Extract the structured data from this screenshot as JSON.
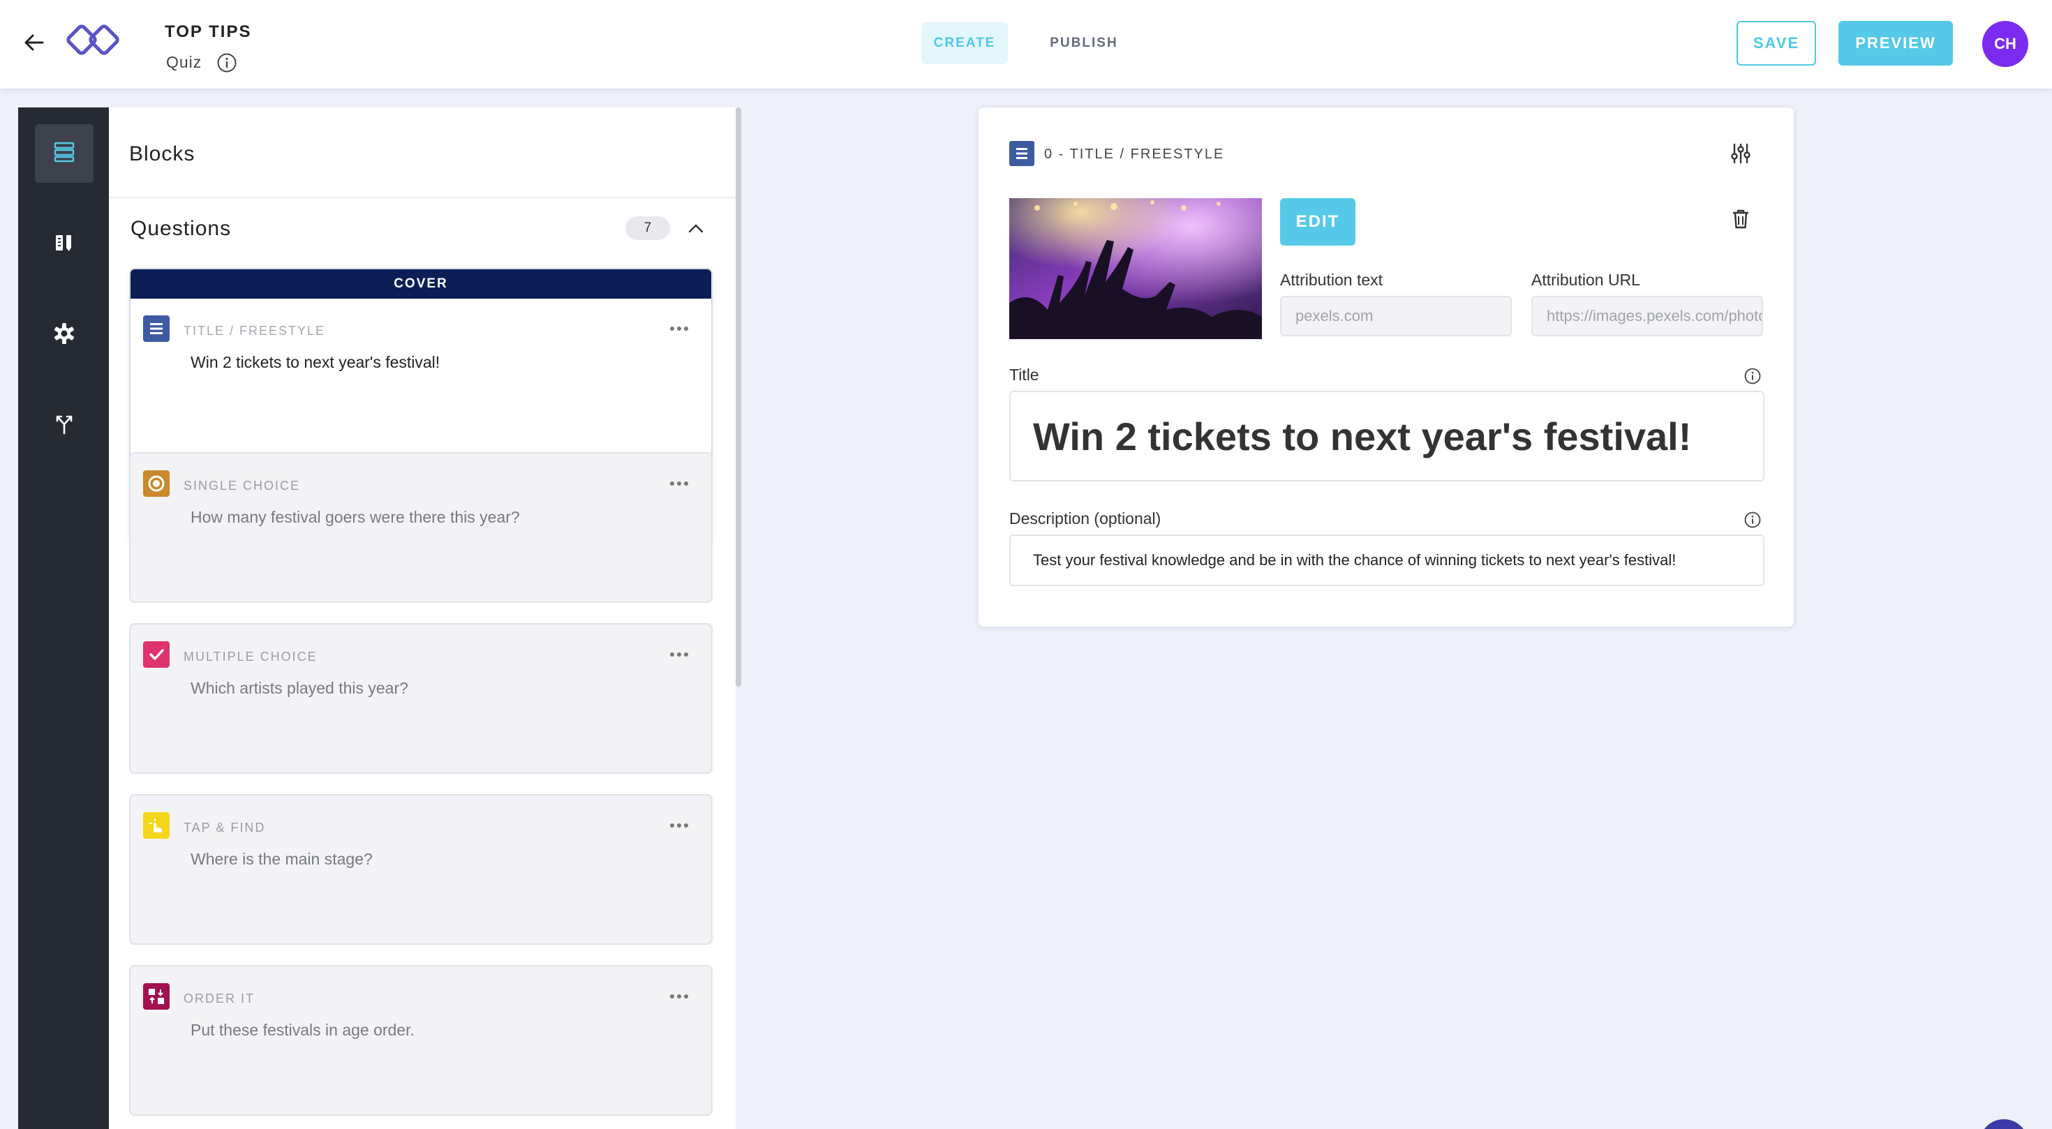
{
  "header": {
    "title": "TOP TIPS",
    "subtitle": "Quiz",
    "tabs": [
      {
        "label": "CREATE",
        "active": true
      },
      {
        "label": "PUBLISH",
        "active": false
      }
    ],
    "save_label": "SAVE",
    "preview_label": "PREVIEW",
    "avatar_initials": "CH"
  },
  "rail": {
    "items": [
      {
        "icon": "blocks-icon",
        "active": true
      },
      {
        "icon": "design-icon",
        "active": false
      },
      {
        "icon": "gear-icon",
        "active": false
      },
      {
        "icon": "branch-icon",
        "active": false
      }
    ]
  },
  "blocks": {
    "title": "Blocks",
    "questions_label": "Questions",
    "questions_count": "7",
    "cover": {
      "banner": "COVER",
      "type": "TITLE / FREESTYLE",
      "text": "Win 2 tickets to next year's festival!"
    },
    "items": [
      {
        "type": "SINGLE CHOICE",
        "text": "How many festival goers were there this year?",
        "icon": "single-choice-icon",
        "color": "#c98a2c"
      },
      {
        "type": "MULTIPLE CHOICE",
        "text": "Which artists played this year?",
        "icon": "checkbox-icon",
        "color": "#e0336b"
      },
      {
        "type": "TAP & FIND",
        "text": "Where is the main stage?",
        "icon": "tap-icon",
        "color": "#f5d61b"
      },
      {
        "type": "ORDER IT",
        "text": "Put these festivals in age order.",
        "icon": "order-icon",
        "color": "#a3124f"
      }
    ]
  },
  "editor": {
    "heading": "0 - TITLE / FREESTYLE",
    "edit_label": "EDIT",
    "attribution_text_label": "Attribution text",
    "attribution_text_value": "pexels.com",
    "attribution_url_label": "Attribution URL",
    "attribution_url_value": "https://images.pexels.com/photos/",
    "title_label": "Title",
    "title_value": "Win 2 tickets to next year's festival!",
    "description_label": "Description (optional)",
    "description_value": "Test your festival knowledge and be in with the chance of winning tickets to next year's festival!"
  },
  "colors": {
    "accent": "#56c9e8",
    "navy": "#0b1f56",
    "avatar": "#7b2cf0",
    "rail": "#262a33"
  }
}
